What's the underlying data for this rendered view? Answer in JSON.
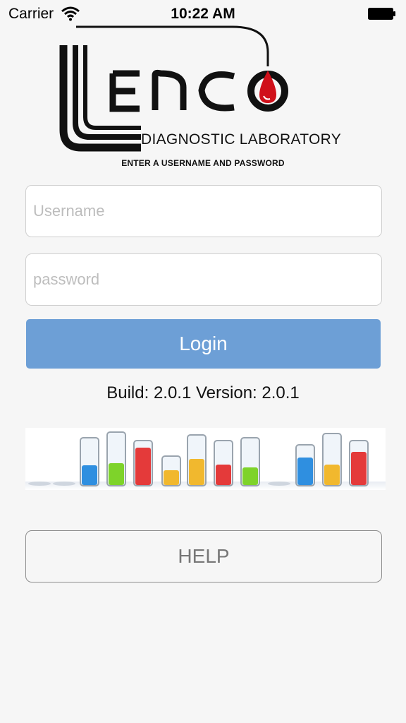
{
  "status_bar": {
    "carrier": "Carrier",
    "time": "10:22 AM"
  },
  "logo": {
    "name": "LENCO",
    "tagline": "DIAGNOSTIC LABORATORY"
  },
  "instructions": "ENTER A USERNAME AND PASSWORD",
  "form": {
    "username_placeholder": "Username",
    "password_placeholder": "password",
    "login_label": "Login"
  },
  "build_info": "Build: 2.0.1 Version: 2.0.1",
  "help_label": "HELP",
  "colors": {
    "background": "#f6f6f6",
    "login_button": "#6d9fd6",
    "logo_drop": "#d0101a"
  },
  "icons": {
    "wifi": "wifi-icon",
    "battery": "battery-icon",
    "banner": "test-tubes-image"
  }
}
